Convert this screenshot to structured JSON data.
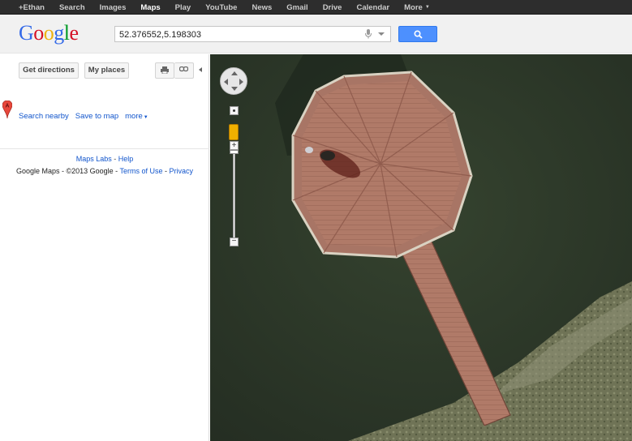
{
  "topbar": {
    "items": [
      {
        "label": "+Ethan",
        "active": false
      },
      {
        "label": "Search",
        "active": false
      },
      {
        "label": "Images",
        "active": false
      },
      {
        "label": "Maps",
        "active": true
      },
      {
        "label": "Play",
        "active": false
      },
      {
        "label": "YouTube",
        "active": false
      },
      {
        "label": "News",
        "active": false
      },
      {
        "label": "Gmail",
        "active": false
      },
      {
        "label": "Drive",
        "active": false
      },
      {
        "label": "Calendar",
        "active": false
      },
      {
        "label": "More",
        "active": false
      }
    ]
  },
  "header": {
    "logo_letters": [
      "G",
      "o",
      "o",
      "g",
      "l",
      "e"
    ],
    "logo_colors": [
      "#3369e8",
      "#d50f25",
      "#eeb211",
      "#3369e8",
      "#009925",
      "#d50f25"
    ],
    "search_value": "52.376552,5.198303",
    "search_button_color": "#4d90fe"
  },
  "panel": {
    "get_directions": "Get directions",
    "my_places": "My places",
    "marker_label": "A",
    "search_nearby": "Search nearby",
    "save_to_map": "Save to map",
    "more": "more",
    "maps_labs": "Maps Labs",
    "help": "Help",
    "footer_text": "Google Maps - ©2013 Google - ",
    "terms": "Terms of Use",
    "privacy": "Privacy",
    "link_color": "#1155cc"
  },
  "map": {
    "view": "satellite",
    "zoom_in": "+",
    "zoom_out": "−",
    "icons": [
      "pan-control",
      "pegman-icon",
      "print-icon",
      "link-icon",
      "search-icon",
      "mic-icon"
    ]
  }
}
